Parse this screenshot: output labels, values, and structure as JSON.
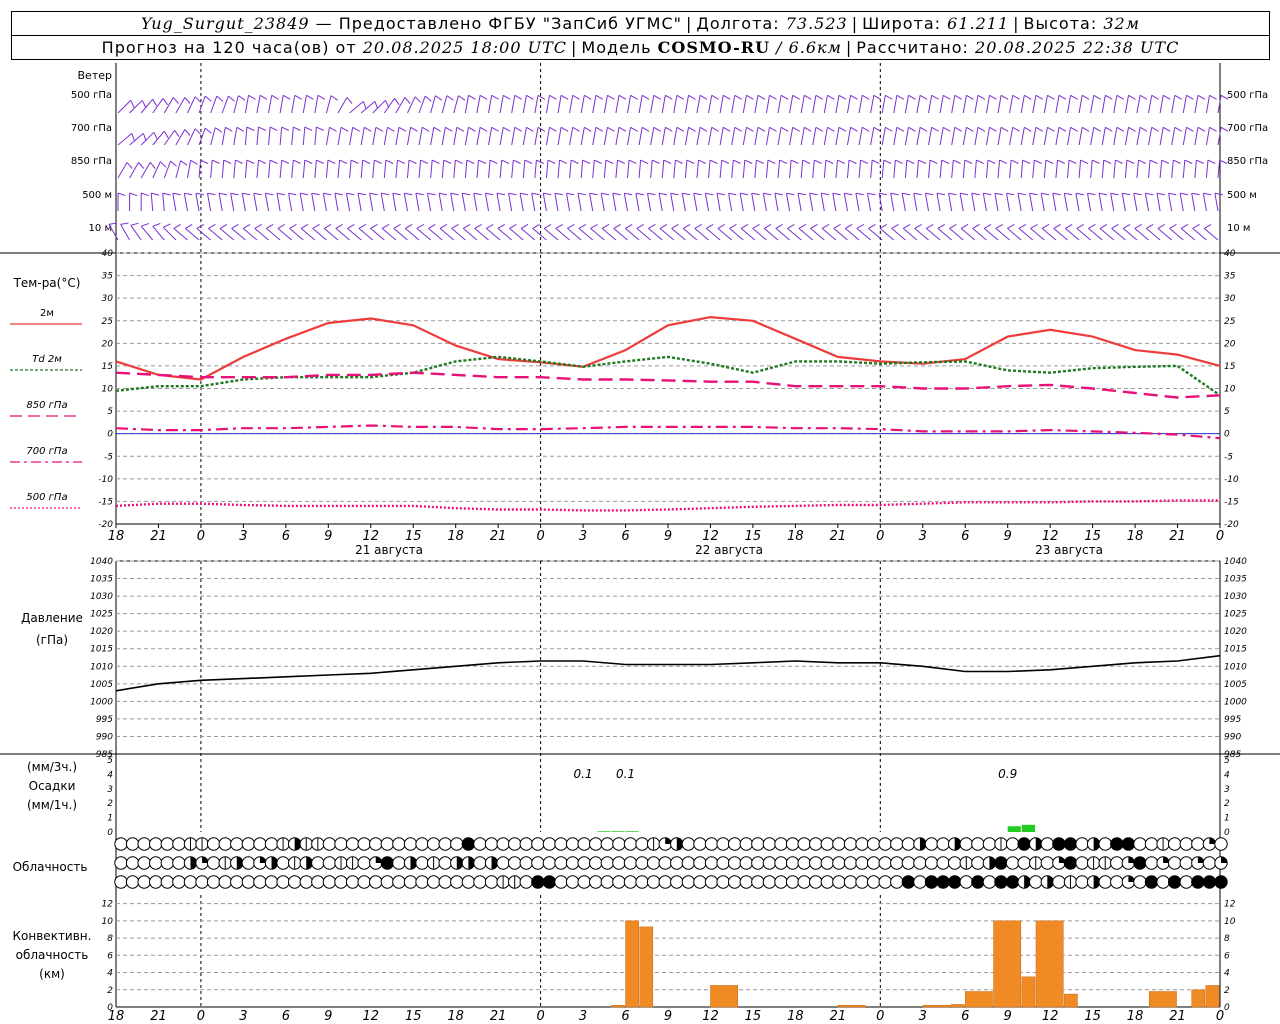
{
  "header": {
    "station": "Yug_Surgut_23849",
    "provider": "— Предоставлено ФГБУ \"ЗапСиб УГМС\"",
    "lon_label": "Долгота:",
    "lon": "73.523",
    "lat_label": "Широта:",
    "lat": "61.211",
    "alt_label": "Высота:",
    "alt": "32м",
    "forecast_prefix": "Прогноз на 120 часа(ов) от",
    "forecast_time": "20.08.2025 18:00 UTC",
    "model_label": "Модель",
    "model": "COSMO-RU",
    "resolution": "/ 6.6км",
    "calc_label": "Рассчитано:",
    "calc_time": "20.08.2025 22:38 UTC"
  },
  "panels": {
    "wind": {
      "title": "Ветер",
      "levels": [
        "500 гПа",
        "700 гПа",
        "850 гПа",
        "500 м",
        "10 м"
      ]
    },
    "temp": {
      "title": "Тем-ра(°С)",
      "legend": [
        {
          "label": "2м",
          "color": "#ee3b3b",
          "dash": ""
        },
        {
          "label": "Td 2м",
          "color": "#1f7a1f",
          "dash": "3,2"
        },
        {
          "label": "850 гПа",
          "color": "#e8117a",
          "dash": "12,6"
        },
        {
          "label": "700 гПа",
          "color": "#e8117a",
          "dash": "10,4,3,4"
        },
        {
          "label": "500 гПа",
          "color": "#e8117a",
          "dash": "2,2"
        }
      ]
    },
    "pressure": {
      "title": "Давление",
      "unit": "(гПа)"
    },
    "precip": {
      "unit3": "(мм/3ч.)",
      "title": "Осадки",
      "unit1": "(мм/1ч.)"
    },
    "cloud": {
      "title": "Облачность"
    },
    "conv": {
      "title": "Конвективн.",
      "title2": "облачность",
      "unit": "(км)"
    }
  },
  "chart_data": {
    "type": "line",
    "x_tick_labels": [
      "18",
      "21",
      "0",
      "3",
      "6",
      "9",
      "12",
      "15",
      "18",
      "21",
      "0",
      "3",
      "6",
      "9",
      "12",
      "15",
      "18",
      "21",
      "0",
      "3",
      "6",
      "9",
      "12",
      "15",
      "18",
      "21",
      "0"
    ],
    "day_labels": [
      "21 августа",
      "22 августа",
      "23 августа"
    ],
    "temperature": {
      "ylim": [
        -20,
        40
      ],
      "yticks": [
        -20,
        -15,
        -10,
        -5,
        0,
        5,
        10,
        15,
        20,
        25,
        30,
        35,
        40
      ],
      "x_hours": [
        0,
        3,
        6,
        9,
        12,
        15,
        18,
        21,
        24,
        27,
        30,
        33,
        36,
        39,
        42,
        45,
        48,
        51,
        54,
        57,
        60,
        63,
        66,
        69,
        72,
        75,
        78
      ],
      "series": [
        {
          "name": "2м",
          "color": "#ee3b3b",
          "values": [
            16,
            13,
            12,
            17,
            21,
            24.5,
            25.5,
            24,
            19.5,
            16.5,
            15.8,
            14.8,
            18.5,
            24,
            25.8,
            25,
            21,
            17,
            16,
            15.5,
            16.5,
            21.5,
            23,
            21.5,
            18.5,
            17.5,
            15
          ]
        },
        {
          "name": "Td 2м",
          "color": "#1f7a1f",
          "values": [
            9.5,
            10.5,
            10.5,
            12,
            12.5,
            12.5,
            12.5,
            13.5,
            16,
            17,
            16,
            14.8,
            16,
            17,
            15.5,
            13.5,
            16,
            16,
            15.5,
            15.8,
            16,
            14,
            13.5,
            14.5,
            14.8,
            15,
            8.5
          ]
        },
        {
          "name": "850 гПа",
          "color": "#e8117a",
          "values": [
            13.5,
            13,
            12.5,
            12.5,
            12.5,
            13,
            13,
            13.5,
            13,
            12.5,
            12.5,
            12,
            12,
            11.8,
            11.5,
            11.5,
            10.5,
            10.5,
            10.5,
            10,
            10,
            10.5,
            10.8,
            10,
            9,
            8,
            8.5
          ]
        },
        {
          "name": "700 гПа",
          "color": "#e8117a",
          "values": [
            1.2,
            0.8,
            0.8,
            1.2,
            1.2,
            1.5,
            1.8,
            1.5,
            1.5,
            1,
            1,
            1.2,
            1.5,
            1.5,
            1.5,
            1.5,
            1.2,
            1.2,
            1,
            0.5,
            0.5,
            0.5,
            0.8,
            0.5,
            0.2,
            -0.2,
            -1
          ]
        },
        {
          "name": "500 гПа",
          "color": "#e8117a",
          "values": [
            -16,
            -15.5,
            -15.5,
            -15.8,
            -16,
            -16,
            -16,
            -16,
            -16.5,
            -16.8,
            -16.8,
            -17,
            -17,
            -16.8,
            -16.5,
            -16.2,
            -16,
            -15.8,
            -15.8,
            -15.5,
            -15.2,
            -15.2,
            -15.2,
            -15,
            -15,
            -14.8,
            -14.8
          ]
        }
      ]
    },
    "pressure": {
      "ylim": [
        985,
        1040
      ],
      "yticks": [
        985,
        990,
        995,
        1000,
        1005,
        1010,
        1015,
        1020,
        1025,
        1030,
        1035,
        1040
      ],
      "x_hours": [
        0,
        3,
        6,
        9,
        12,
        15,
        18,
        21,
        24,
        27,
        30,
        33,
        36,
        39,
        42,
        45,
        48,
        51,
        54,
        57,
        60,
        63,
        66,
        69,
        72,
        75,
        78
      ],
      "values": [
        1003,
        1005,
        1006,
        1006.5,
        1007,
        1007.5,
        1008,
        1009,
        1010,
        1011,
        1011.5,
        1011.5,
        1010.5,
        1010.5,
        1010.5,
        1011,
        1011.5,
        1011,
        1011,
        1010,
        1008.5,
        1008.5,
        1009,
        1010,
        1011,
        1011.5,
        1013
      ]
    },
    "precipitation": {
      "ylim": [
        0,
        5
      ],
      "yticks": [
        0,
        1,
        2,
        3,
        4,
        5
      ],
      "labels": [
        {
          "hour": 33,
          "text": "0.1"
        },
        {
          "hour": 36,
          "text": "0.1"
        },
        {
          "hour": 63,
          "text": "0.9"
        }
      ],
      "bars": [
        {
          "hour": 34,
          "value": 0.05
        },
        {
          "hour": 35,
          "value": 0.05
        },
        {
          "hour": 36,
          "value": 0.05
        },
        {
          "hour": 63,
          "value": 0.4
        },
        {
          "hour": 64,
          "value": 0.5
        }
      ]
    },
    "cloud_rows": [
      "000000110000001311000000000000400000000000000012300000000000000000000300300010430440304400100020",
      "000000320130230130011024030103303000000000000000000000000000000000000000010340010240110240200202",
      "000000000000000000000000000000000110440000000000000000000000000000004044404044303010300204040444"
    ],
    "convective": {
      "ylim": [
        0,
        13
      ],
      "yticks": [
        0,
        2,
        4,
        6,
        8,
        10,
        12
      ],
      "bars": [
        {
          "start": 35,
          "end": 36,
          "value": 0.2
        },
        {
          "start": 36,
          "end": 37,
          "value": 10
        },
        {
          "start": 37,
          "end": 38,
          "value": 9.3
        },
        {
          "start": 42,
          "end": 44,
          "value": 2.5
        },
        {
          "start": 51,
          "end": 53,
          "value": 0.2
        },
        {
          "start": 57,
          "end": 59,
          "value": 0.2
        },
        {
          "start": 59,
          "end": 60,
          "value": 0.3
        },
        {
          "start": 60,
          "end": 62,
          "value": 1.8
        },
        {
          "start": 62,
          "end": 64,
          "value": 10
        },
        {
          "start": 64,
          "end": 65,
          "value": 3.5
        },
        {
          "start": 65,
          "end": 67,
          "value": 10
        },
        {
          "start": 67,
          "end": 68,
          "value": 1.5
        },
        {
          "start": 73,
          "end": 75,
          "value": 1.8
        },
        {
          "start": 76,
          "end": 77,
          "value": 2
        },
        {
          "start": 77,
          "end": 78,
          "value": 2.5
        }
      ]
    },
    "wind_barbs": {
      "color": "#7b2fd0",
      "levels": [
        [
          45,
          45,
          50,
          55,
          60,
          60,
          65,
          70,
          70,
          70,
          75,
          80,
          80,
          80,
          80,
          80,
          80,
          80,
          75,
          60,
          40,
          40,
          45,
          55,
          60,
          65,
          70,
          75,
          75,
          75,
          80,
          80,
          80,
          80,
          80,
          80,
          80,
          80,
          80,
          80,
          80,
          80,
          80,
          80,
          80,
          80,
          80,
          80,
          80,
          80,
          80,
          80,
          80,
          80,
          80,
          80,
          80,
          80,
          80,
          80,
          80,
          80,
          80,
          80,
          80,
          80,
          80,
          80,
          80,
          80,
          80,
          80,
          80,
          80,
          80,
          80,
          80,
          80,
          80,
          80,
          80,
          80,
          80,
          80,
          80,
          80,
          80,
          80,
          80,
          80,
          80,
          80,
          80,
          80,
          80,
          80
        ],
        [
          40,
          40,
          45,
          50,
          55,
          60,
          65,
          70,
          75,
          80,
          80,
          85,
          85,
          85,
          85,
          85,
          85,
          85,
          80,
          80,
          80,
          80,
          80,
          80,
          80,
          80,
          80,
          80,
          80,
          80,
          80,
          80,
          80,
          80,
          80,
          80,
          80,
          80,
          80,
          80,
          80,
          80,
          80,
          80,
          80,
          80,
          80,
          80,
          80,
          80,
          80,
          80,
          80,
          80,
          80,
          80,
          80,
          80,
          80,
          80,
          80,
          80,
          80,
          80,
          80,
          80,
          80,
          80,
          80,
          80,
          80,
          80,
          80,
          80,
          80,
          80,
          80,
          80,
          80,
          80,
          80,
          80,
          80,
          80,
          80,
          80,
          80,
          80,
          80,
          80,
          80,
          80,
          80,
          80,
          80,
          80
        ],
        [
          60,
          60,
          60,
          65,
          70,
          75,
          80,
          85,
          85,
          85,
          85,
          85,
          85,
          85,
          85,
          85,
          85,
          85,
          85,
          85,
          85,
          85,
          85,
          85,
          85,
          85,
          85,
          85,
          85,
          85,
          85,
          85,
          85,
          85,
          85,
          85,
          85,
          85,
          85,
          85,
          85,
          85,
          85,
          85,
          85,
          85,
          85,
          85,
          85,
          85,
          85,
          85,
          85,
          85,
          85,
          85,
          85,
          85,
          85,
          85,
          85,
          85,
          85,
          85,
          85,
          85,
          85,
          85,
          85,
          85,
          85,
          85,
          85,
          85,
          85,
          85,
          85,
          85,
          85,
          85,
          85,
          85,
          85,
          85,
          85,
          85,
          85,
          85,
          85,
          85,
          85,
          85,
          85,
          85,
          85,
          85
        ],
        [
          90,
          90,
          90,
          95,
          95,
          100,
          100,
          100,
          100,
          100,
          100,
          100,
          100,
          100,
          100,
          100,
          100,
          100,
          100,
          100,
          100,
          100,
          100,
          100,
          100,
          100,
          100,
          100,
          100,
          100,
          100,
          100,
          100,
          100,
          100,
          100,
          100,
          100,
          100,
          100,
          100,
          100,
          100,
          100,
          100,
          100,
          100,
          100,
          100,
          100,
          100,
          100,
          100,
          100,
          100,
          100,
          100,
          100,
          100,
          100,
          100,
          100,
          100,
          100,
          100,
          100,
          100,
          100,
          100,
          100,
          100,
          100,
          100,
          100,
          100,
          100,
          100,
          100,
          100,
          100,
          100,
          100,
          100,
          100,
          100,
          100,
          100,
          100,
          100,
          100,
          100,
          100,
          100,
          100,
          100,
          100
        ],
        [
          120,
          120,
          125,
          130,
          130,
          135,
          140,
          140,
          140,
          140,
          140,
          140,
          140,
          140,
          140,
          140,
          140,
          140,
          140,
          140,
          140,
          140,
          140,
          140,
          140,
          140,
          140,
          140,
          140,
          140,
          140,
          140,
          140,
          140,
          140,
          140,
          140,
          140,
          140,
          140,
          140,
          140,
          140,
          140,
          140,
          140,
          140,
          140,
          140,
          140,
          140,
          140,
          140,
          140,
          140,
          140,
          140,
          140,
          140,
          140,
          140,
          140,
          140,
          140,
          140,
          140,
          140,
          140,
          140,
          140,
          140,
          140,
          140,
          140,
          140,
          140,
          140,
          140,
          140,
          140,
          140,
          140,
          140,
          140,
          140,
          140,
          140,
          140,
          140,
          140,
          140,
          140,
          140,
          140,
          140,
          140
        ]
      ]
    }
  }
}
